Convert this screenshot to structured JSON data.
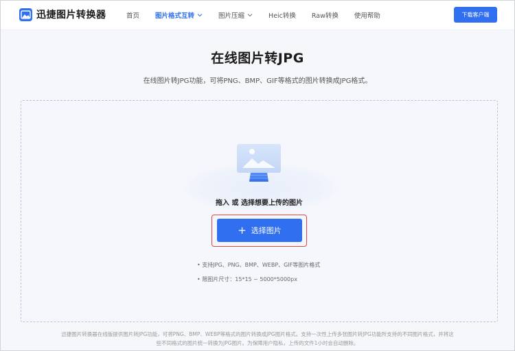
{
  "header": {
    "logo_text": "迅捷图片转换器",
    "nav": [
      {
        "label": "首页",
        "active": false,
        "dropdown": false
      },
      {
        "label": "图片格式互转",
        "active": true,
        "dropdown": true
      },
      {
        "label": "图片压缩",
        "active": false,
        "dropdown": true
      },
      {
        "label": "Heic转换",
        "active": false,
        "dropdown": false
      },
      {
        "label": "Raw转换",
        "active": false,
        "dropdown": false
      },
      {
        "label": "使用帮助",
        "active": false,
        "dropdown": false
      }
    ],
    "download_label": "下载客户端"
  },
  "main": {
    "title": "在线图片转JPG",
    "subtitle": "在线图片转JPG功能，可将PNG、BMP、GIF等格式的图片转换成JPG格式。"
  },
  "upload": {
    "hint": "拖入 或 选择想要上传的图片",
    "button_label": "选择图片",
    "notes": [
      "• 支持JPG、PNG、BMP、WEBP、GIF等图片格式",
      "• 限图片尺寸：15*15 ~ 5000*5000px"
    ]
  },
  "footer": {
    "line1": "迅捷图片转换器在线版提供图片转JPG功能，可将PNG、BMP、WEBP等格式的图片转换成JPG图片格式。支持一次性上传多张图片转JPG功能所支持的不同图片格式，并将这",
    "line2": "些不同格式的图片统一转换为JPG图片。为保障用户隐私，上传的文件1小时会自动删除。"
  },
  "colors": {
    "accent": "#2f6ff0",
    "highlight_border": "#e0463c",
    "page_bg": "#f6f7fb"
  },
  "icons": [
    "logo-icon",
    "chevron-down-icon",
    "image-upload-illustration",
    "plus-icon"
  ]
}
